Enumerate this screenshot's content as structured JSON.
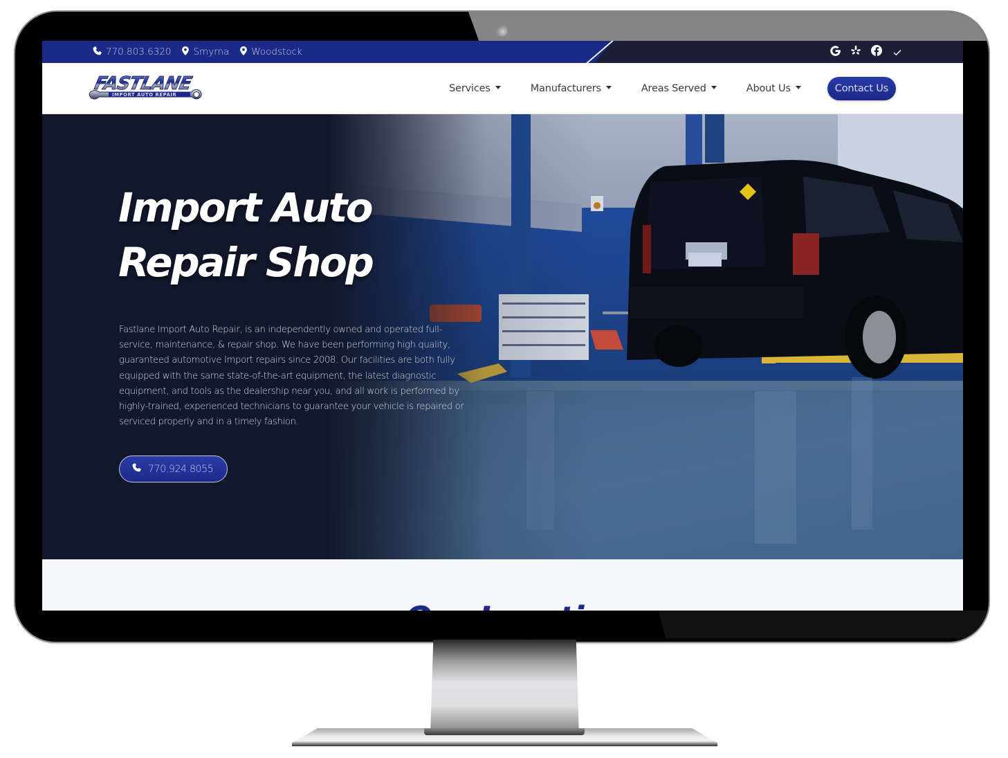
{
  "topbar": {
    "phone": "770.803.6320",
    "locations": [
      "Smyrna",
      "Woodstock"
    ],
    "social": [
      {
        "name": "google-icon",
        "label": "Google"
      },
      {
        "name": "yelp-icon",
        "label": "Yelp"
      },
      {
        "name": "facebook-icon",
        "label": "Facebook"
      },
      {
        "name": "check-icon",
        "label": "Verified"
      }
    ]
  },
  "brand": {
    "logo_word": "FASTLANE",
    "logo_tagline": "IMPORT AUTO REPAIR"
  },
  "nav": {
    "items": [
      {
        "label": "Services",
        "has_dropdown": true
      },
      {
        "label": "Manufacturers",
        "has_dropdown": true
      },
      {
        "label": "Areas Served",
        "has_dropdown": true
      },
      {
        "label": "About Us",
        "has_dropdown": true
      }
    ],
    "cta_label": "Contact Us"
  },
  "hero": {
    "title_line1": "Import Auto",
    "title_line2": "Repair Shop",
    "description": "Fastlane Import Auto Repair, is an independently owned and operated full-service, maintenance, & repair shop. We have been performing high quality, guaranteed automotive Import repairs since 2008. Our facilities are both fully equipped with the same state-of-the-art equipment, the latest diagnostic equipment, and tools as the dealership near you, and all work is performed by highly-trained, experienced technicians to guarantee your vehicle is repaired or serviced properly and in a timely fashion.",
    "phone_button": "770.924.8055"
  },
  "section2": {
    "heading_partial": "Our Locations"
  },
  "colors": {
    "brand_blue": "#1b2a86",
    "topbar_dark": "#1a1f36",
    "hero_dark": "#12182c"
  }
}
